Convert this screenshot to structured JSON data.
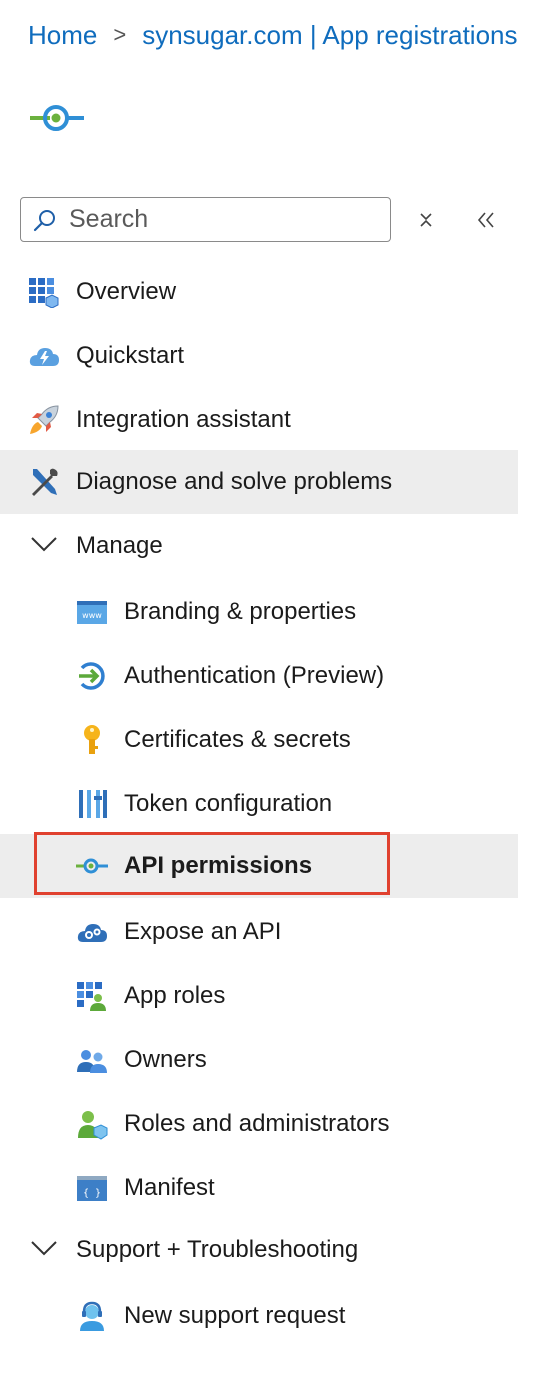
{
  "breadcrumb": {
    "home": "Home",
    "separator": ">",
    "current": "synsugar.com | App registrations"
  },
  "search": {
    "placeholder": "Search",
    "value": ""
  },
  "nav": {
    "items": [
      {
        "label": "Overview",
        "icon": "overview-icon"
      },
      {
        "label": "Quickstart",
        "icon": "quickstart-cloud-icon"
      },
      {
        "label": "Integration assistant",
        "icon": "rocket-icon"
      },
      {
        "label": "Diagnose and solve problems",
        "icon": "wrench-screwdriver-icon",
        "selected": true
      }
    ],
    "groups": [
      {
        "label": "Manage",
        "expanded": true,
        "items": [
          {
            "label": "Branding & properties",
            "icon": "www-window-icon"
          },
          {
            "label": "Authentication (Preview)",
            "icon": "authentication-icon"
          },
          {
            "label": "Certificates & secrets",
            "icon": "key-icon"
          },
          {
            "label": "Token configuration",
            "icon": "token-bars-icon"
          },
          {
            "label": "API permissions",
            "icon": "api-permissions-icon",
            "selected": true,
            "highlighted": true
          },
          {
            "label": "Expose an API",
            "icon": "cloud-gears-icon"
          },
          {
            "label": "App roles",
            "icon": "app-roles-icon"
          },
          {
            "label": "Owners",
            "icon": "owners-icon"
          },
          {
            "label": "Roles and administrators",
            "icon": "roles-admin-icon"
          },
          {
            "label": "Manifest",
            "icon": "manifest-icon"
          }
        ]
      },
      {
        "label": "Support + Troubleshooting",
        "expanded": true,
        "items": [
          {
            "label": "New support request",
            "icon": "support-agent-icon"
          }
        ]
      }
    ]
  },
  "colors": {
    "accent": "#0f6cbd",
    "highlight_border": "#e0412f",
    "selected_bg": "#ededed"
  }
}
